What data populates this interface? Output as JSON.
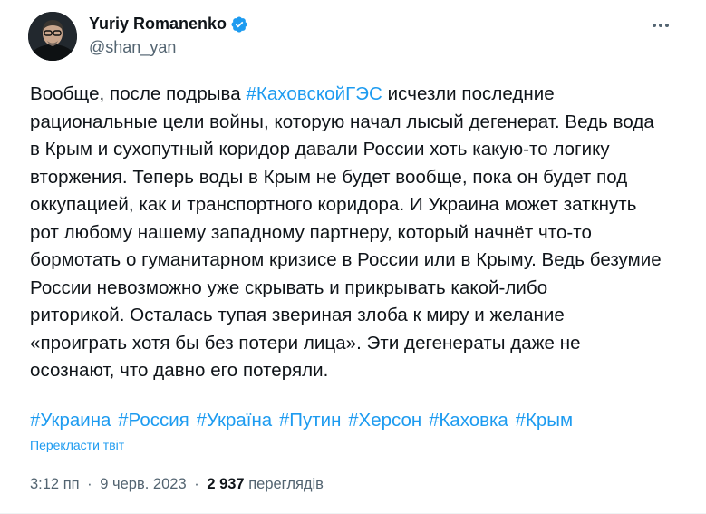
{
  "author": {
    "display_name": "Yuriy Romanenko",
    "handle": "@shan_yan",
    "verified": true
  },
  "tweet": {
    "lines": [
      [
        {
          "t": "Вообще, после подрыва "
        },
        {
          "t": "#КаховскойГЭС",
          "tag": true
        },
        {
          "t": " исчезли последние"
        }
      ],
      [
        {
          "t": "рациональные цели войны, которую начал лысый дегенерат. Ведь вода"
        }
      ],
      [
        {
          "t": "в Крым и сухопутный коридор давали России хоть какую-то логику"
        }
      ],
      [
        {
          "t": "вторжения. Теперь воды в Крым не будет вообще, пока он будет под"
        }
      ],
      [
        {
          "t": "оккупацией, как и транспортного коридора. И Украина может заткнуть"
        }
      ],
      [
        {
          "t": "рот любому нашему западному партнеру, который начнёт что-то"
        }
      ],
      [
        {
          "t": "бормотать о гуманитарном кризисе в России или в Крыму. Ведь безумие"
        }
      ],
      [
        {
          "t": "России невозможно уже скрывать и прикрывать какой-либо"
        }
      ],
      [
        {
          "t": "риторикой. Осталась тупая звериная злоба к миру и желание"
        }
      ],
      [
        {
          "t": "«проиграть хотя бы без потери лица». Эти дегенераты даже не"
        }
      ],
      [
        {
          "t": "осознают, что давно его потеряли."
        }
      ]
    ],
    "hashtags": [
      "#Украина",
      "#Россия",
      "#Україна",
      "#Путин",
      "#Херсон",
      "#Каховка",
      "#Крым"
    ],
    "translate_label": "Перекласти твіт",
    "time": "3:12 пп",
    "separator": "·",
    "date": "9 черв. 2023",
    "views_count": "2 937",
    "views_label": "переглядів"
  },
  "colors": {
    "accent": "#1d9bf0",
    "text": "#0f1419",
    "secondary": "#536471"
  },
  "icons": {
    "more": "more-horizontal-icon",
    "verified": "verified-badge-icon"
  }
}
